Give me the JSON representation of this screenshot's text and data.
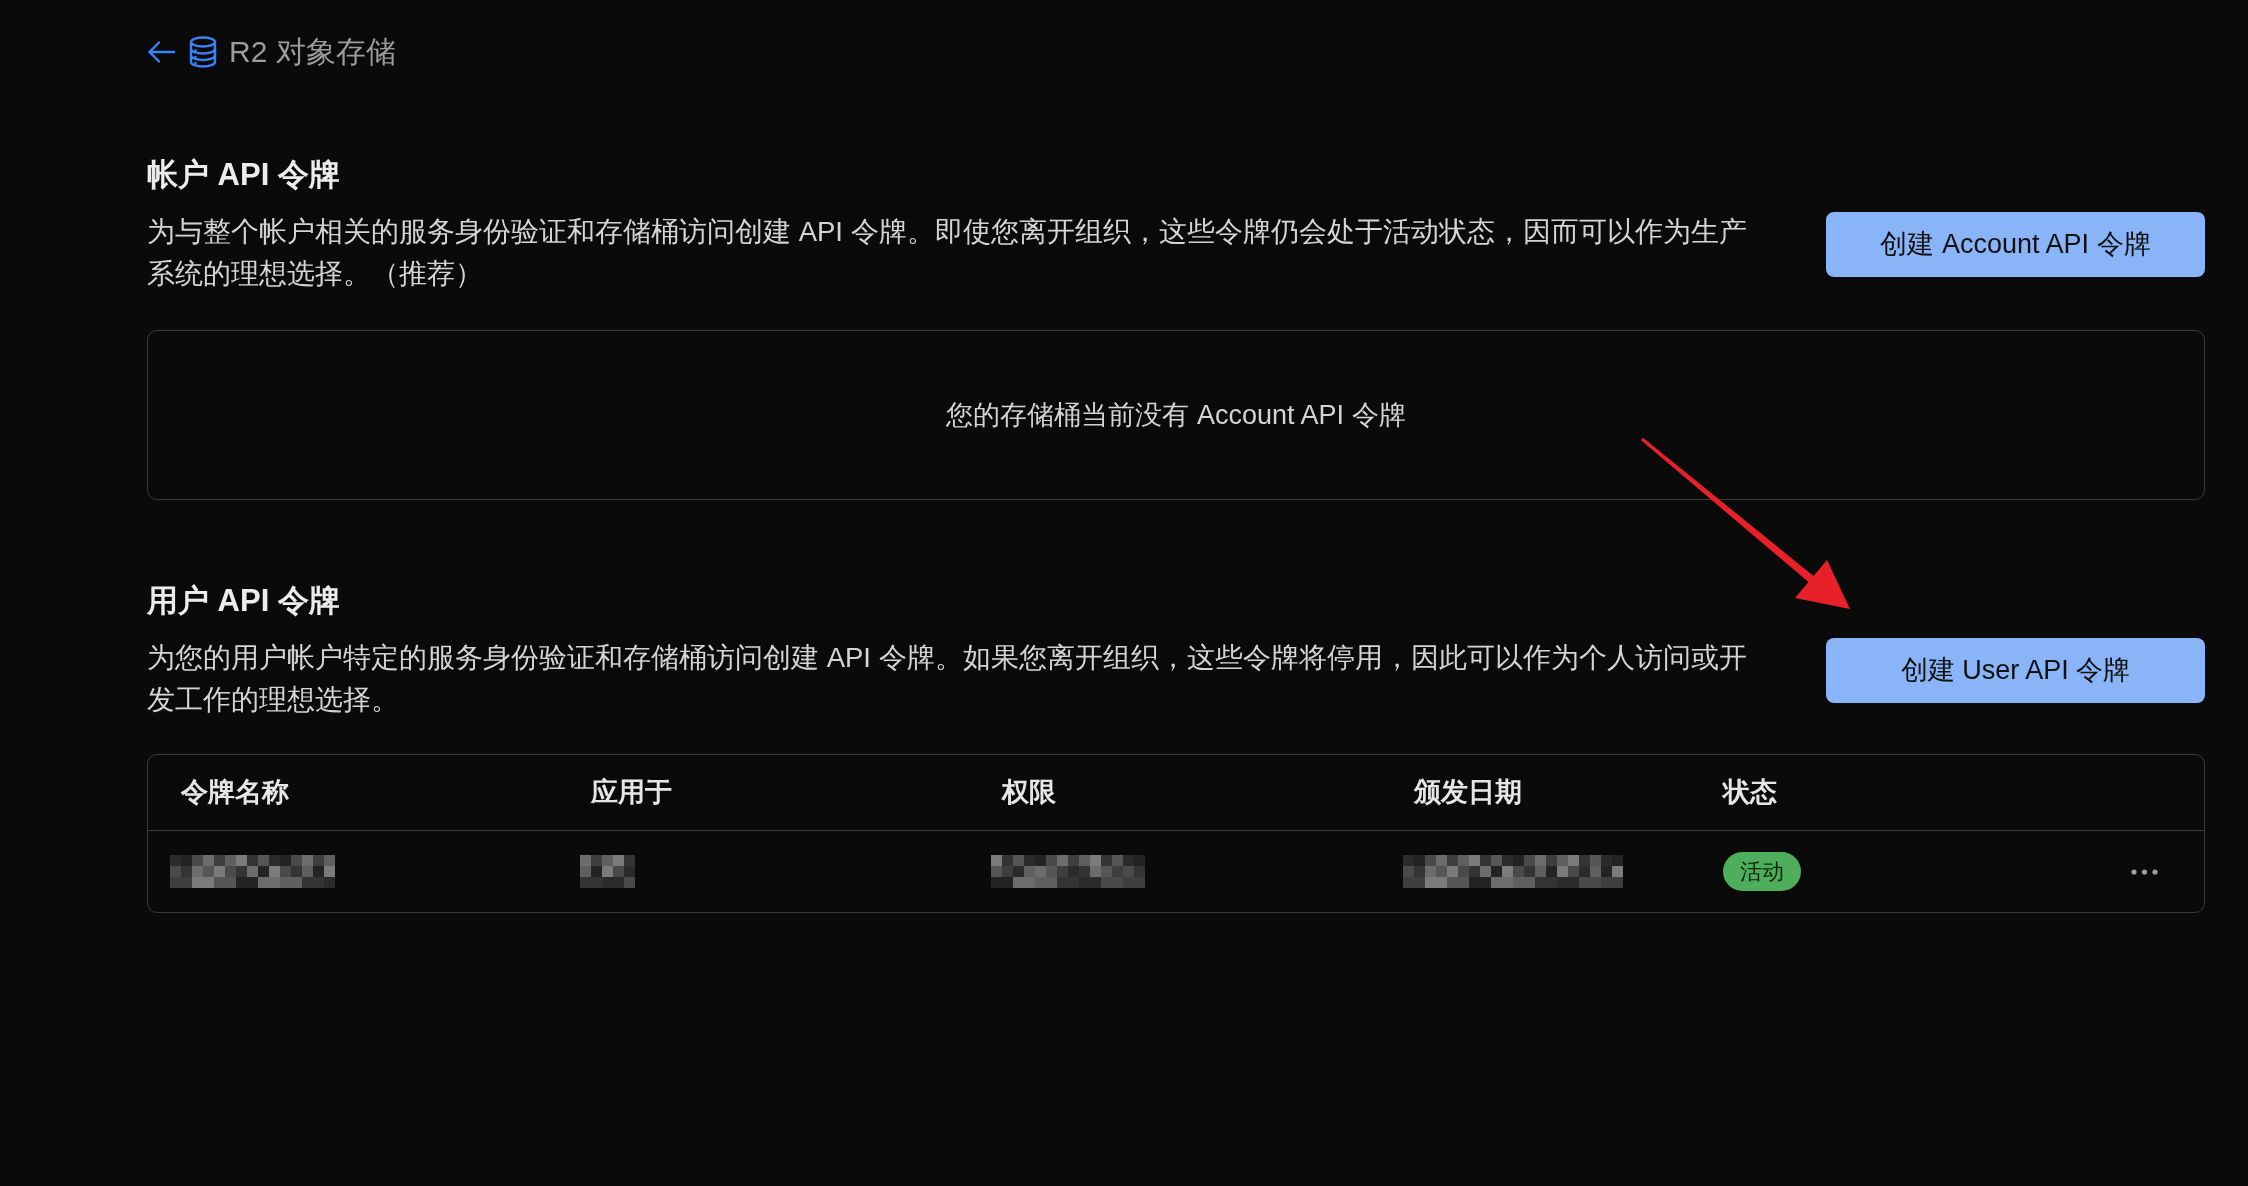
{
  "header": {
    "title": "R2 对象存储"
  },
  "account_tokens": {
    "heading": "帐户 API 令牌",
    "description": "为与整个帐户相关的服务身份验证和存储桶访问创建 API 令牌。即使您离开组织，这些令牌仍会处于活动状态，因而可以作为生产系统的理想选择。（推荐）",
    "create_button": "创建 Account API 令牌",
    "empty_message": "您的存储桶当前没有 Account API 令牌"
  },
  "user_tokens": {
    "heading": "用户 API 令牌",
    "description": "为您的用户帐户特定的服务身份验证和存储桶访问创建 API 令牌。如果您离开组织，这些令牌将停用，因此可以作为个人访问或开发工作的理想选择。",
    "create_button": "创建 User API 令牌",
    "table": {
      "columns": [
        "令牌名称",
        "应用于",
        "权限",
        "颁发日期",
        "状态"
      ],
      "rows": [
        {
          "cells": [
            {
              "redacted": true
            },
            {
              "redacted": true
            },
            {
              "redacted": true
            },
            {
              "redacted": true
            }
          ],
          "status": {
            "text": "活动",
            "color": "#4fae5c"
          }
        }
      ]
    }
  }
}
